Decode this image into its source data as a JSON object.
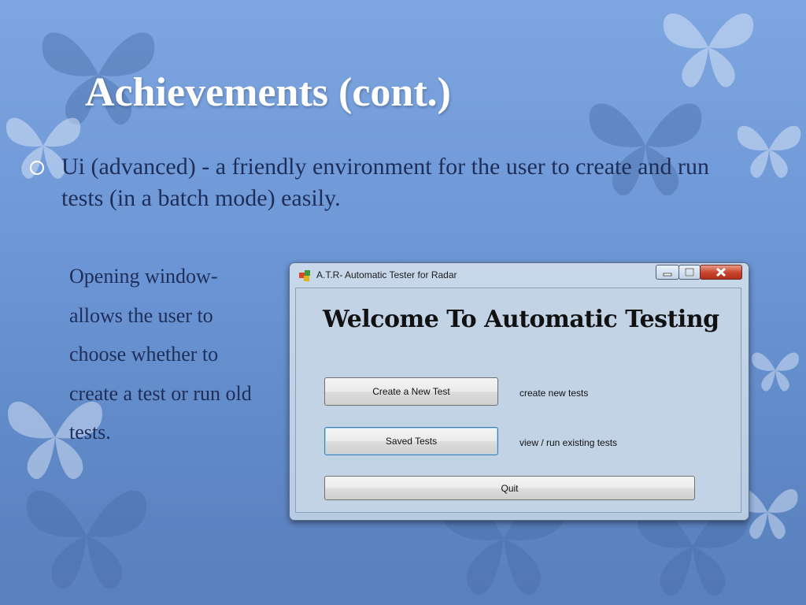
{
  "slide": {
    "title": "Achievements (cont.)",
    "bullet": "Ui (advanced) - a friendly environment for the user to create and run tests (in a batch mode) easily.",
    "side_text": "Opening window- allows the user to choose whether to create a test or run old tests."
  },
  "window": {
    "title": "A.T.R- Automatic Tester for Radar",
    "heading": "Welcome To Automatic Testing",
    "buttons": {
      "create": "Create a New Test",
      "saved": "Saved Tests",
      "quit": "Quit"
    },
    "descriptions": {
      "create": "create new tests",
      "saved": "view / run existing tests"
    }
  },
  "icons": [
    "butterfly-icon",
    "minimize-icon",
    "maximize-icon",
    "close-icon",
    "app-icon"
  ]
}
